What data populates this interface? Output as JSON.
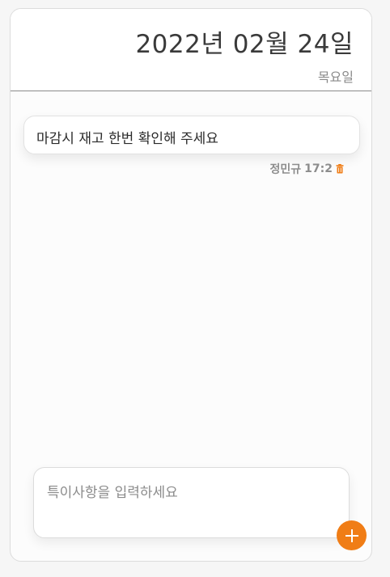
{
  "header": {
    "date": "2022년 02월 24일",
    "weekday": "목요일"
  },
  "messages": [
    {
      "text": "마감시 재고 한번 확인해 주세요",
      "author": "정민규",
      "time": "17:2",
      "delete_icon": "trash-icon"
    }
  ],
  "input": {
    "placeholder": "특이사항을 입력하세요",
    "value": ""
  },
  "add_button": {
    "icon": "plus-icon"
  },
  "colors": {
    "accent": "#f07d16",
    "text": "#2a2a2a",
    "muted": "#8a8a8a"
  }
}
